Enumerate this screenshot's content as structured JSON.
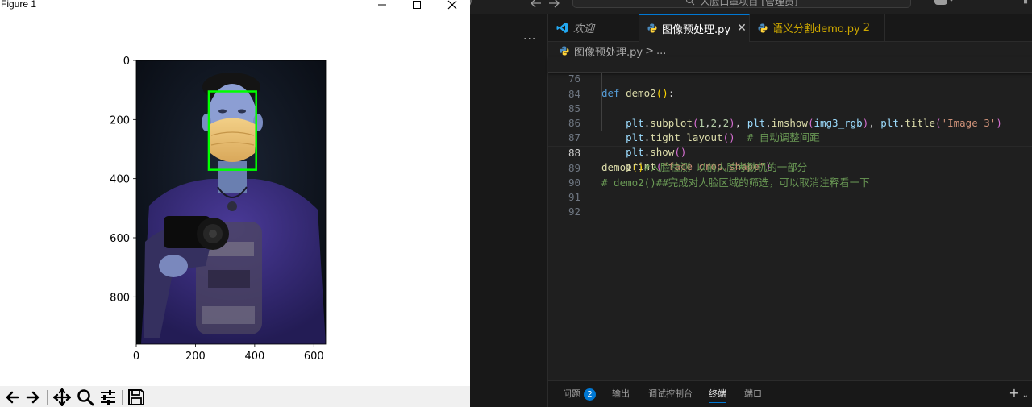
{
  "figure_window": {
    "title": "Figure 1",
    "controls": [
      "minimize-icon",
      "maximize-icon",
      "close-icon"
    ],
    "toolbar": [
      "back-arrow-icon",
      "forward-arrow-icon",
      "pan-icon",
      "zoom-icon",
      "configure-subplots-icon",
      "save-icon"
    ]
  },
  "chart_data": {
    "type": "image",
    "x_ticks": [
      "0",
      "200",
      "400",
      "600"
    ],
    "y_ticks": [
      "0",
      "200",
      "400",
      "600",
      "800"
    ],
    "xlim": [
      0,
      640
    ],
    "ylim": [
      960,
      0
    ],
    "overlay": {
      "kind": "rectangle",
      "color": "#00ff00",
      "x": [
        245,
        405
      ],
      "y": [
        105,
        370
      ]
    }
  },
  "vscode": {
    "search_text": "人脸口罩项目 [管理员]",
    "tabs": [
      {
        "label": "欢迎",
        "icon": "vscode-logo-icon"
      },
      {
        "label": "图像预处理.py",
        "icon": "python-file-icon",
        "active": true
      },
      {
        "label": "语义分割demo.py",
        "badge": "2",
        "icon": "python-file-icon"
      }
    ],
    "breadcrumb": {
      "file": "图像预处理.py",
      "sep": ">",
      "rest": "..."
    },
    "lines": [
      {
        "n": "76",
        "t": [
          "def",
          " ",
          "demo2",
          "(",
          ")",
          ":"
        ]
      },
      {
        "n": "84",
        "t": [
          "    ",
          "plt",
          ".",
          "subplot",
          "(",
          "1",
          ",",
          "2",
          ",",
          "2",
          ")",
          ", ",
          "plt",
          ".",
          "imshow",
          "(",
          "img3_rgb",
          ")",
          ", ",
          "plt",
          ".",
          "title",
          "(",
          "'Image 3'",
          ")"
        ]
      },
      {
        "n": "85",
        "t": [
          "    ",
          "plt",
          ".",
          "tight_layout",
          "(",
          ")",
          "  ",
          "# 自动调整间距"
        ]
      },
      {
        "n": "86",
        "t": [
          "    ",
          "plt",
          ".",
          "show",
          "(",
          ")"
        ]
      },
      {
        "n": "87",
        "t": [
          "    ",
          "print",
          "(",
          "\"face_crop.shape\"",
          ")"
        ]
      },
      {
        "n": "88",
        "t": [
          "demo1",
          "(",
          ")",
          "#人脸检测 以前人脸考勤机的一部分"
        ]
      },
      {
        "n": "89",
        "t": [
          "# demo2()##完成对人脸区域的筛选，可以取消注释看一下"
        ]
      },
      {
        "n": "90",
        "t": []
      },
      {
        "n": "91",
        "t": []
      },
      {
        "n": "92",
        "t": []
      }
    ],
    "panel_tabs": [
      {
        "label": "问题",
        "badge": "2"
      },
      {
        "label": "输出"
      },
      {
        "label": "调试控制台"
      },
      {
        "label": "终端",
        "active": true
      },
      {
        "label": "端口"
      }
    ]
  }
}
